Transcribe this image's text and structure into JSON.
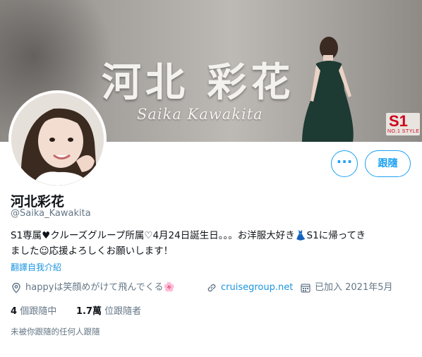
{
  "banner": {
    "name_text": "河北 彩花",
    "sub_text": "Saika Kawakita",
    "logo_mark": "S1",
    "logo_sub": "NO.1 STYLE"
  },
  "actions": {
    "more_label": "···",
    "follow_label": "跟隨"
  },
  "profile": {
    "display_name": "河北彩花",
    "handle": "@Saika_Kawakita",
    "bio_line1": "S1専属♥クルーズグループ所属♡4月24日誕生日。。。お洋服大好き👗S1に帰ってき",
    "bio_line2": "ました☺応援よろしくお願いします！",
    "translate_label": "翻譯自我介紹",
    "location": "happyは笑顔めがけて飛んでくる🌸",
    "website": "cruisegroup.net",
    "joined": "已加入 2021年5月"
  },
  "stats": {
    "following_count": "4",
    "following_label": "個跟隨中",
    "followers_count": "1.7萬",
    "followers_label": "位跟隨者"
  },
  "followers_note": "未被你跟隨的任何人跟隨",
  "colors": {
    "accent": "#1da1f2",
    "link": "#1b95e0",
    "secondary_text": "#657786",
    "heart": "#e0245e"
  }
}
